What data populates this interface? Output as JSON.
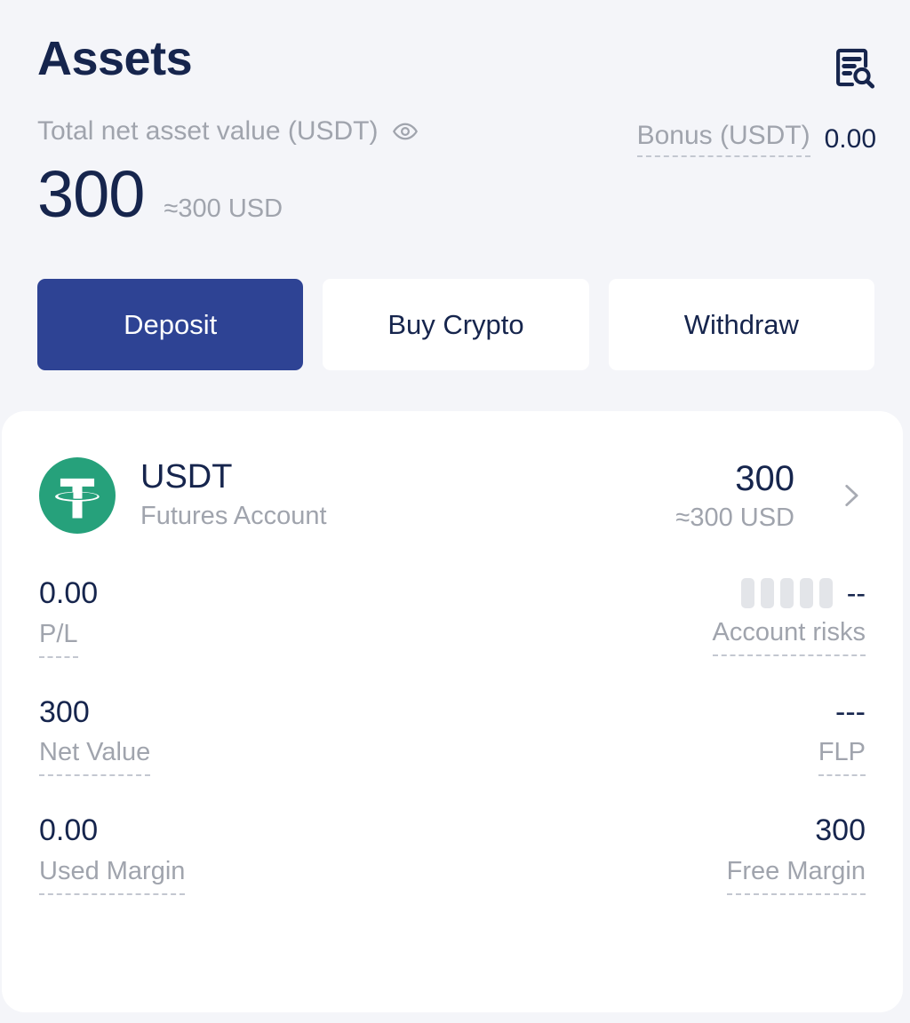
{
  "header": {
    "title": "Assets",
    "record_icon": "document-search-icon"
  },
  "balance": {
    "label": "Total net asset value (USDT)",
    "visibility_icon": "eye-icon",
    "amount": "300",
    "approx": "≈300 USD",
    "bonus_label": "Bonus (USDT)",
    "bonus_value": "0.00"
  },
  "actions": {
    "deposit": "Deposit",
    "buy_crypto": "Buy Crypto",
    "withdraw": "Withdraw"
  },
  "asset": {
    "icon": "tether-usdt-icon",
    "symbol": "USDT",
    "account_type": "Futures Account",
    "amount": "300",
    "approx": "≈300 USD",
    "chevron": "chevron-right-icon",
    "stats": {
      "pl_value": "0.00",
      "pl_label": "P/L",
      "risk_value": "--",
      "risk_label": "Account risks",
      "risk_bars_total": 5,
      "risk_bars_active": 0,
      "net_value": "300",
      "net_label": "Net Value",
      "flp_value": "---",
      "flp_label": "FLP",
      "used_margin_value": "0.00",
      "used_margin_label": "Used Margin",
      "free_margin_value": "300",
      "free_margin_label": "Free Margin"
    }
  },
  "colors": {
    "page_bg": "#f4f5f9",
    "card_bg": "#ffffff",
    "primary": "#2e4394",
    "text_dark": "#16254d",
    "text_muted": "#a0a4ad",
    "tether_green": "#26a17b"
  }
}
